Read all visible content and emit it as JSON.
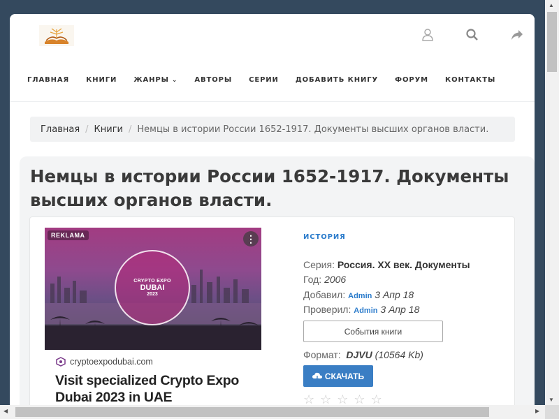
{
  "header": {
    "icons": [
      "user-icon",
      "search-icon",
      "share-icon"
    ]
  },
  "nav": {
    "items": [
      {
        "label": "ГЛАВНАЯ"
      },
      {
        "label": "КНИГИ"
      },
      {
        "label": "ЖАНРЫ",
        "has_dropdown": true
      },
      {
        "label": "АВТОРЫ"
      },
      {
        "label": "СЕРИИ"
      },
      {
        "label": "ДОБАВИТЬ КНИГУ"
      },
      {
        "label": "ФОРУМ"
      },
      {
        "label": "КОНТАКТЫ"
      }
    ]
  },
  "breadcrumb": {
    "home": "Главная",
    "books": "Книги",
    "current": "Немцы в истории России 1652-1917. Документы высших органов власти."
  },
  "book": {
    "title": "Немцы в истории России 1652-1917. Документы высших органов власти.",
    "genre": "ИСТОРИЯ",
    "series_label": "Серия:",
    "series_value": "Россия. XX век. Документы",
    "year_label": "Год:",
    "year_value": "2006",
    "added_label": "Добавил:",
    "added_user": "Admin",
    "added_date": "3 Апр 18",
    "checked_label": "Проверил:",
    "checked_user": "Admin",
    "checked_date": "3 Апр 18",
    "events_button": "События книги",
    "format_label": "Формат:",
    "format_value": "DJVU",
    "format_size": "(10564 Kb)",
    "download_button": "СКАЧАТЬ",
    "rating_stars": 5
  },
  "ad": {
    "badge": "REKLAMA",
    "circle_line1": "CRYPTO EXPO",
    "circle_line2": "DUBAI",
    "circle_line3": "2023",
    "source": "cryptoexpodubai.com",
    "headline": "Visit specialized Crypto Expo Dubai 2023 in UAE"
  },
  "colors": {
    "page_background": "#34495e",
    "accent_blue": "#3a7ec4",
    "link_blue": "#2a7bcb"
  }
}
